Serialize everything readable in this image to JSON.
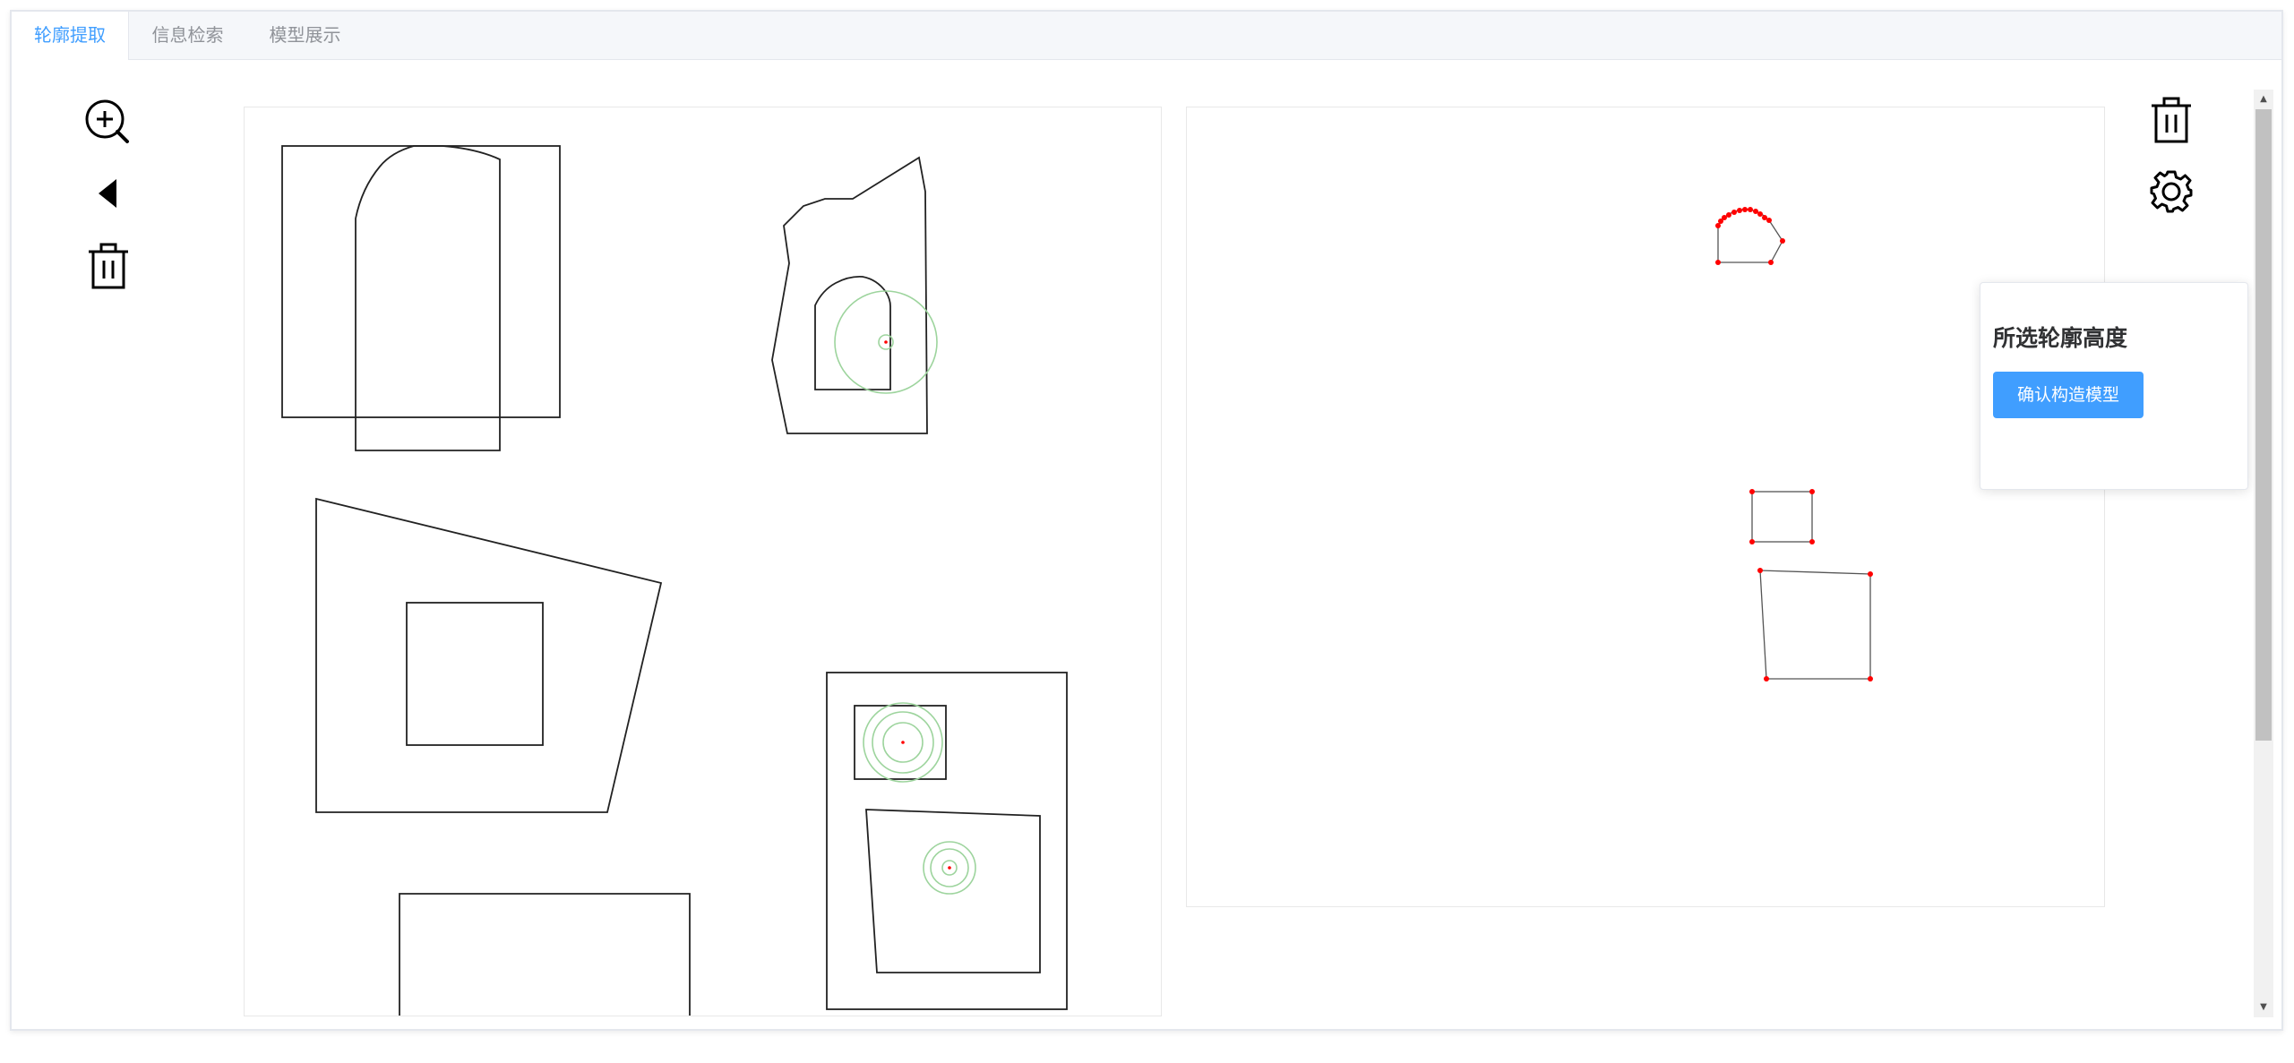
{
  "tabs": [
    {
      "label": "轮廓提取",
      "active": true
    },
    {
      "label": "信息检索",
      "active": false
    },
    {
      "label": "模型展示",
      "active": false
    }
  ],
  "toolbar_left": {
    "icons": [
      "zoom-in-icon",
      "back-triangle-icon",
      "trash-icon"
    ]
  },
  "toolbar_right": {
    "icons": [
      "trash-icon",
      "gear-icon"
    ]
  },
  "popover": {
    "title": "所选轮廓高度",
    "button_label": "确认构造模型"
  },
  "colors": {
    "accent": "#409eff",
    "point_red": "#ff0000",
    "ring_green": "#9dd49d",
    "line_black": "#222222"
  }
}
